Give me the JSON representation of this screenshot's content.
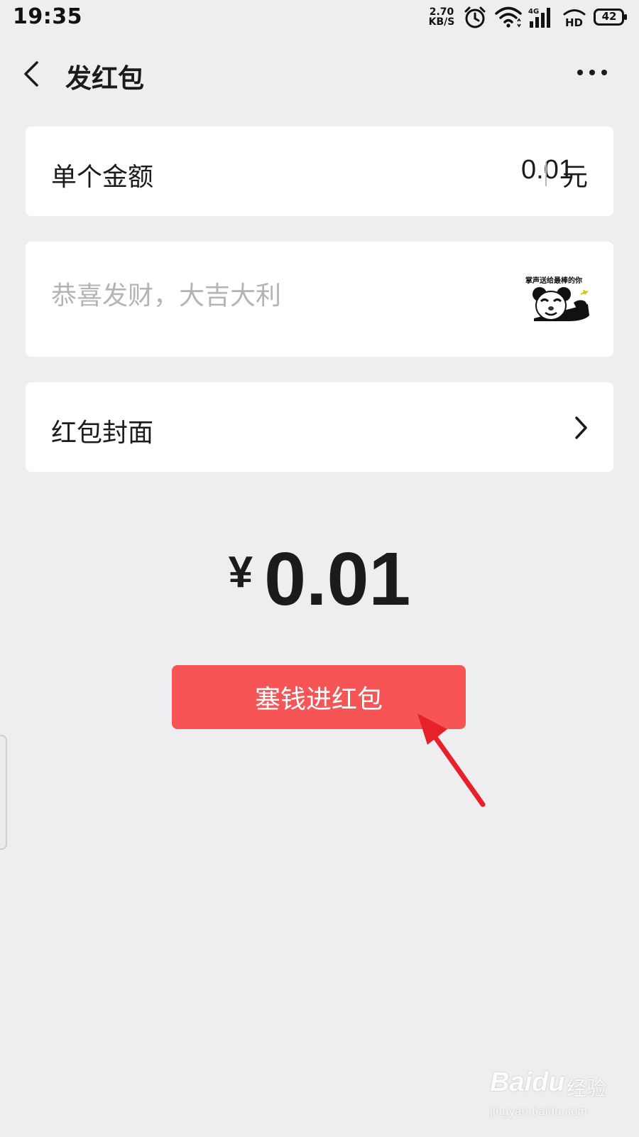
{
  "status_bar": {
    "time": "19:35",
    "net_speed_value": "2.70",
    "net_speed_unit": "KB/S",
    "network_type": "4G",
    "hd_label": "HD",
    "battery_level": "42",
    "icons": [
      "alarm-icon",
      "wifi-icon",
      "signal-icon",
      "hd-icon",
      "battery-icon"
    ]
  },
  "header": {
    "title": "发红包",
    "back_icon": "chevron-left-icon",
    "more_icon": "more-horizontal-icon"
  },
  "amount_field": {
    "label": "单个金额",
    "value": "0.01",
    "unit": "元"
  },
  "greeting_field": {
    "placeholder": "恭喜发财，大吉大利",
    "sticker_caption": "掌声送给最棒的你"
  },
  "cover_field": {
    "label": "红包封面",
    "icon": "chevron-right-icon"
  },
  "amount_display": {
    "currency_symbol": "¥",
    "value": "0.01"
  },
  "submit_button": {
    "label": "塞钱进红包"
  },
  "annotation": {
    "arrow_color": "#E8202A"
  },
  "watermark": {
    "brand": "Baidu",
    "product": "经验",
    "url": "jingyan.baidu.com"
  },
  "colors": {
    "background": "#EEEDF0",
    "card": "#FFFFFF",
    "accent_button": "#F65455",
    "placeholder": "#B4B4B4"
  }
}
